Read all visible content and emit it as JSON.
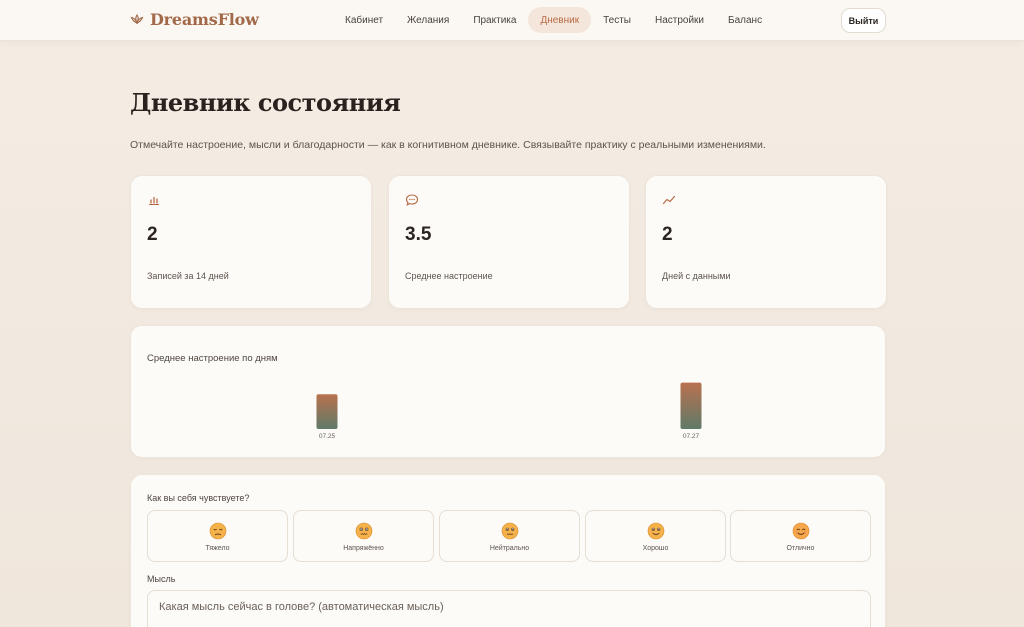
{
  "brand": {
    "name": "DreamsFlow"
  },
  "nav": [
    {
      "label": "Кабинет",
      "active": false
    },
    {
      "label": "Желания",
      "active": false
    },
    {
      "label": "Практика",
      "active": false
    },
    {
      "label": "Дневник",
      "active": true
    },
    {
      "label": "Тесты",
      "active": false
    },
    {
      "label": "Настройки",
      "active": false
    },
    {
      "label": "Баланс",
      "active": false
    }
  ],
  "header": {
    "logout_label": "Выйти"
  },
  "page": {
    "title": "Дневник состояния",
    "subtitle": "Отмечайте настроение, мысли и благодарности — как в когнитивном дневнике. Связывайте практику с реальными изменениями."
  },
  "stats": [
    {
      "icon": "bar-chart-icon",
      "value": "2",
      "label": "Записей за 14 дней"
    },
    {
      "icon": "chat-bubble-icon",
      "value": "3.5",
      "label": "Среднее настроение"
    },
    {
      "icon": "trend-line-icon",
      "value": "2",
      "label": "Дней с данными"
    }
  ],
  "chart_section": {
    "title": "Среднее настроение по дням"
  },
  "chart_data": {
    "type": "bar",
    "title": "Среднее настроение по дням",
    "categories": [
      "07.25",
      "07.27"
    ],
    "values": [
      3,
      4
    ],
    "ylim": [
      0,
      5
    ],
    "grid": false,
    "bar_gradient": [
      "#b9714f",
      "#5f7a68"
    ]
  },
  "mood": {
    "question": "Как вы себя чувствуете?",
    "options": [
      {
        "label": "Тяжело",
        "icon": "sad-face-icon"
      },
      {
        "label": "Напряжённо",
        "icon": "tense-face-icon"
      },
      {
        "label": "Нейтрально",
        "icon": "neutral-face-icon"
      },
      {
        "label": "Хорошо",
        "icon": "smile-face-icon"
      },
      {
        "label": "Отлично",
        "icon": "happy-face-icon"
      }
    ]
  },
  "thought": {
    "label": "Мысль",
    "placeholder": "Какая мысль сейчас в голове? (автоматическая мысль)",
    "value": ""
  },
  "colors": {
    "accent": "#b86a45",
    "active_nav_bg": "#f4e6da",
    "card_bg": "#fdfbf7",
    "page_bg": "#f1e9df"
  }
}
